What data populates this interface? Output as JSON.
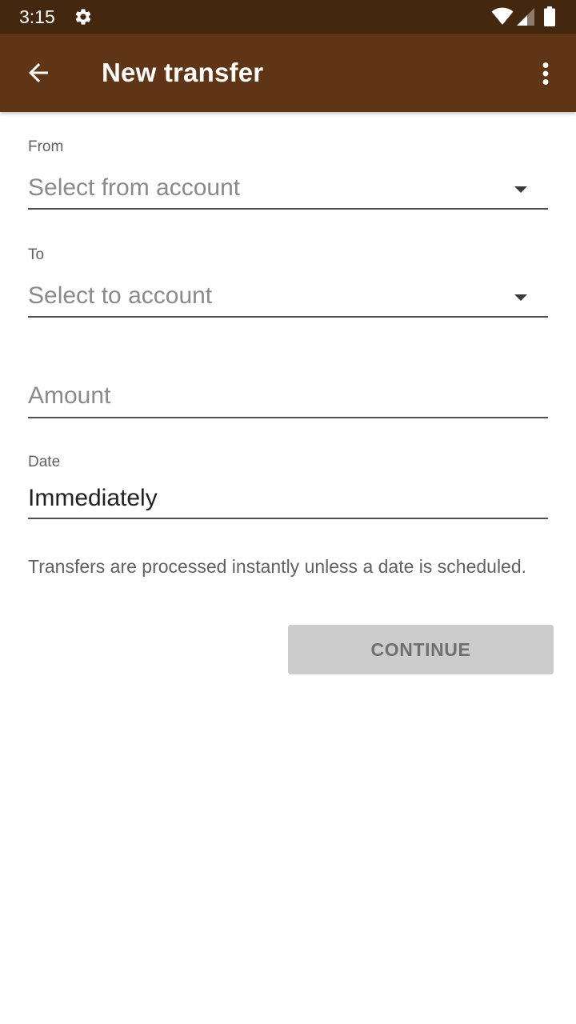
{
  "status_bar": {
    "time": "3:15",
    "icons": [
      "settings-gear-icon",
      "wifi-icon",
      "cell-signal-icon",
      "battery-icon"
    ],
    "background": "#43270f"
  },
  "app_bar": {
    "title": "New transfer",
    "back_icon": "arrow-back-icon",
    "menu_icon": "more-vert-icon",
    "background": "#5f3515"
  },
  "form": {
    "from": {
      "label": "From",
      "placeholder": "Select from account",
      "icon": "dropdown-arrow-icon"
    },
    "to": {
      "label": "To",
      "placeholder": "Select to account",
      "icon": "dropdown-arrow-icon"
    },
    "amount": {
      "placeholder": "Amount"
    },
    "date": {
      "label": "Date",
      "value": "Immediately"
    },
    "helper_text": "Transfers are processed instantly unless a date is scheduled.",
    "continue_label": "CONTINUE",
    "continue_enabled": false
  }
}
